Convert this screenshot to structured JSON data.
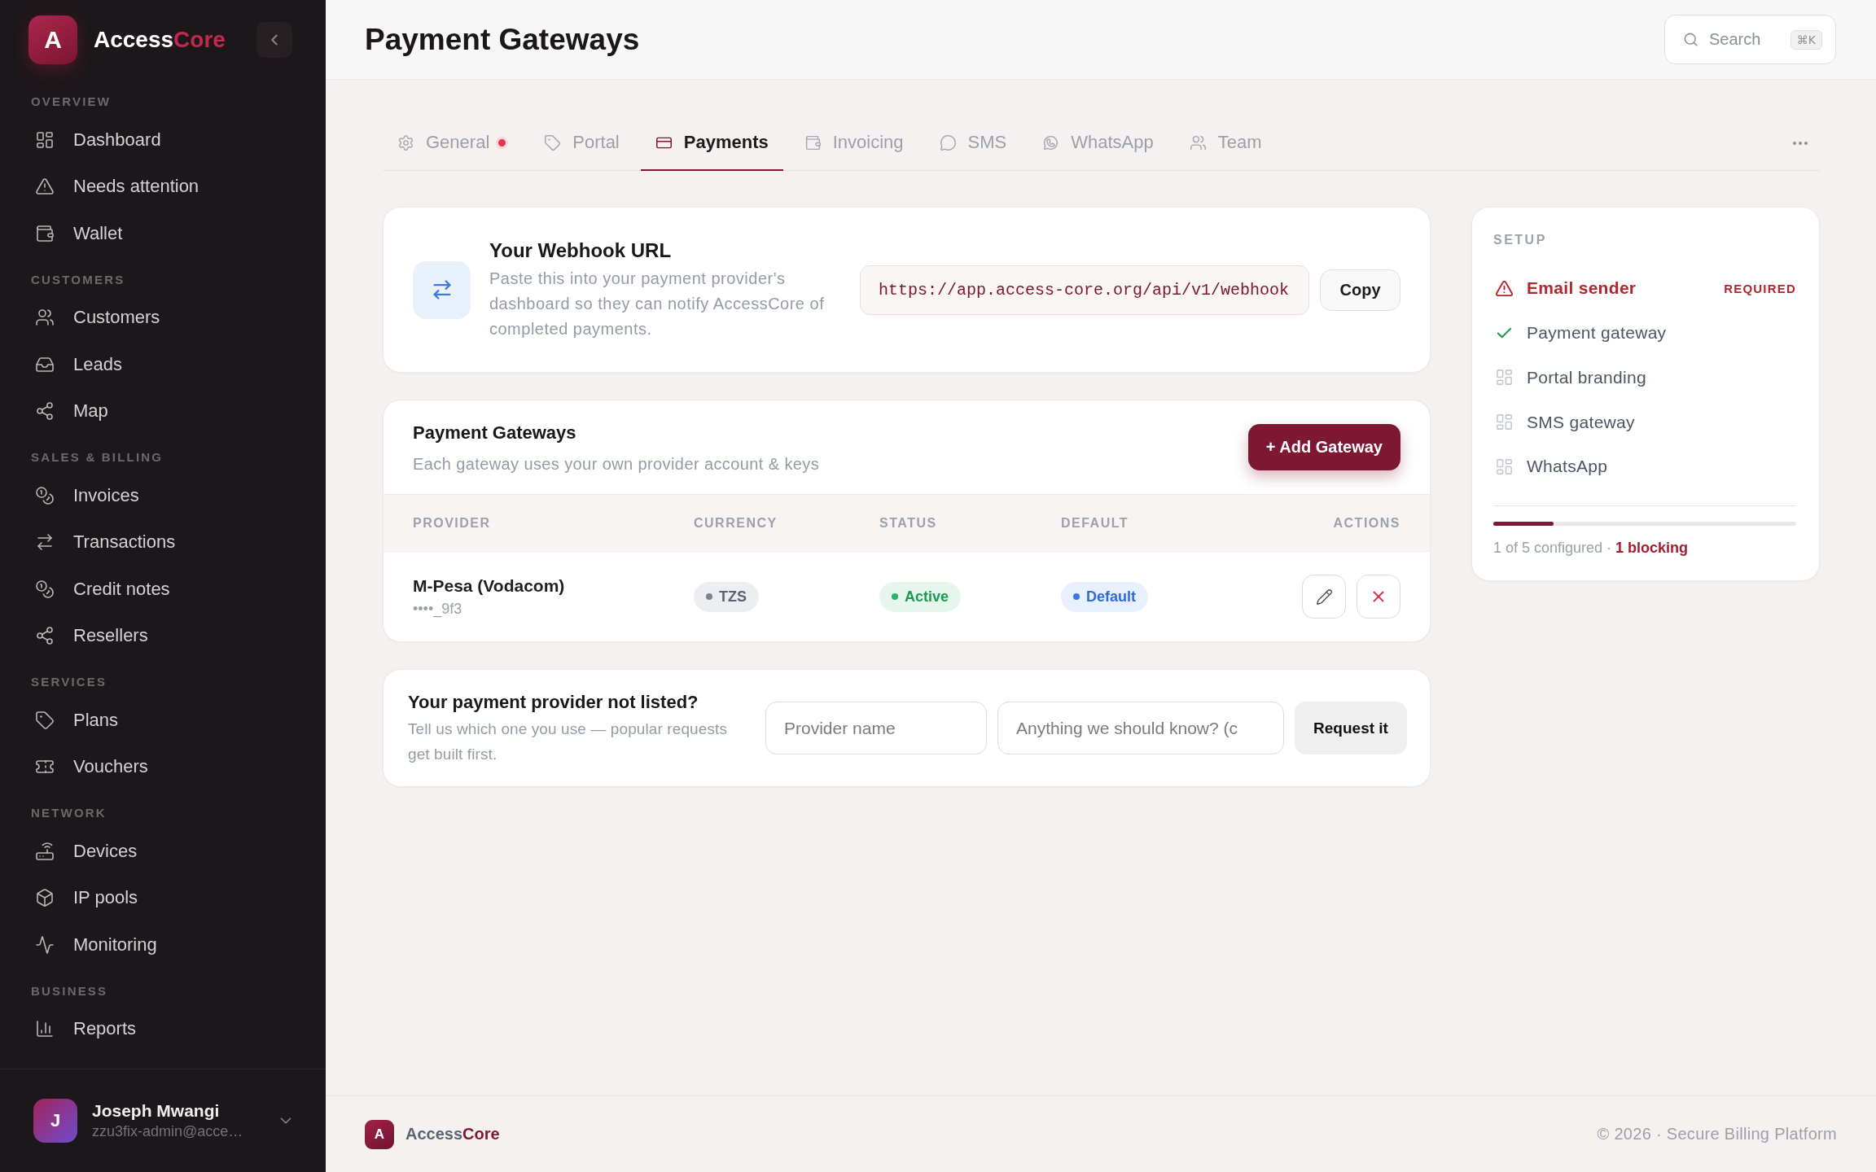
{
  "sidebar": {
    "brand": {
      "logo_letter": "A",
      "name": "Access",
      "name_accent": "Core"
    },
    "sections": [
      {
        "label": "OVERVIEW",
        "items": [
          {
            "label": "Dashboard",
            "selected": false
          },
          {
            "label": "Needs attention",
            "selected": false
          },
          {
            "label": "Wallet",
            "selected": false
          }
        ]
      },
      {
        "label": "CUSTOMERS",
        "items": [
          {
            "label": "Customers",
            "selected": false
          },
          {
            "label": "Leads",
            "selected": false
          },
          {
            "label": "Map",
            "selected": false
          }
        ]
      },
      {
        "label": "SALES & BILLING",
        "items": [
          {
            "label": "Invoices",
            "selected": false
          },
          {
            "label": "Transactions",
            "selected": false
          },
          {
            "label": "Credit notes",
            "selected": false
          },
          {
            "label": "Resellers",
            "selected": false
          }
        ]
      },
      {
        "label": "SERVICES",
        "items": [
          {
            "label": "Plans",
            "selected": false
          },
          {
            "label": "Vouchers",
            "selected": false
          }
        ]
      },
      {
        "label": "NETWORK",
        "items": [
          {
            "label": "Devices",
            "selected": false
          },
          {
            "label": "IP pools",
            "selected": false
          },
          {
            "label": "Monitoring",
            "selected": false
          }
        ]
      },
      {
        "label": "BUSINESS",
        "items": [
          {
            "label": "Reports",
            "selected": false
          }
        ]
      }
    ],
    "user": {
      "initial": "J",
      "name": "Joseph Mwangi",
      "email": "zzu3fix-admin@acce…"
    }
  },
  "header": {
    "title": "Payment Gateways",
    "search": {
      "label": "Search",
      "shortcut": "⌘K"
    }
  },
  "tabs": [
    {
      "label": "General",
      "selected": false,
      "attention": true
    },
    {
      "label": "Portal",
      "selected": false,
      "attention": false
    },
    {
      "label": "Payments",
      "selected": true,
      "attention": false
    },
    {
      "label": "Invoicing",
      "selected": false,
      "attention": false
    },
    {
      "label": "SMS",
      "selected": false,
      "attention": false
    },
    {
      "label": "WhatsApp",
      "selected": false,
      "attention": false
    },
    {
      "label": "Team",
      "selected": false,
      "attention": false
    }
  ],
  "webhook": {
    "title": "Your Webhook URL",
    "description": "Paste this into your payment provider's dashboard so they can notify AccessCore of completed payments.",
    "url": "https://app.access-core.org/api/v1/webhook",
    "copy_button": "Copy"
  },
  "gateways": {
    "title": "Payment Gateways",
    "subtitle": "Each gateway uses your own provider account & keys",
    "add_button": "+ Add Gateway",
    "columns": [
      "PROVIDER",
      "CURRENCY",
      "STATUS",
      "DEFAULT",
      "ACTIONS"
    ],
    "rows": [
      {
        "provider": "M-Pesa (Vodacom)",
        "key": "••••_9f3",
        "currency": "TZS",
        "status": {
          "label": "Active",
          "kind": "active"
        },
        "is_default": true,
        "default_label": "Default"
      }
    ]
  },
  "request": {
    "title": "Your payment provider not listed?",
    "description": "Tell us which one you use — popular requests get built first.",
    "fields": [
      {
        "placeholder": "Provider name"
      },
      {
        "placeholder": "Anything we should know? (c"
      }
    ],
    "button": "Request it"
  },
  "setup": {
    "title": "SETUP",
    "items": [
      {
        "label": "Email sender",
        "kind": "required",
        "badge": "REQUIRED"
      },
      {
        "label": "Payment gateway",
        "kind": "done"
      },
      {
        "label": "Portal branding",
        "kind": "todo"
      },
      {
        "label": "SMS gateway",
        "kind": "todo"
      },
      {
        "label": "WhatsApp",
        "kind": "todo"
      }
    ],
    "progress": {
      "level": 0.2
    },
    "summary": "1 of 5 configured · **1 blocking**"
  },
  "footer": {
    "brand": {
      "logo_letter": "A",
      "name": "Access",
      "name_accent": "Core"
    },
    "copyright": "© 2026 · Secure Billing Platform"
  }
}
